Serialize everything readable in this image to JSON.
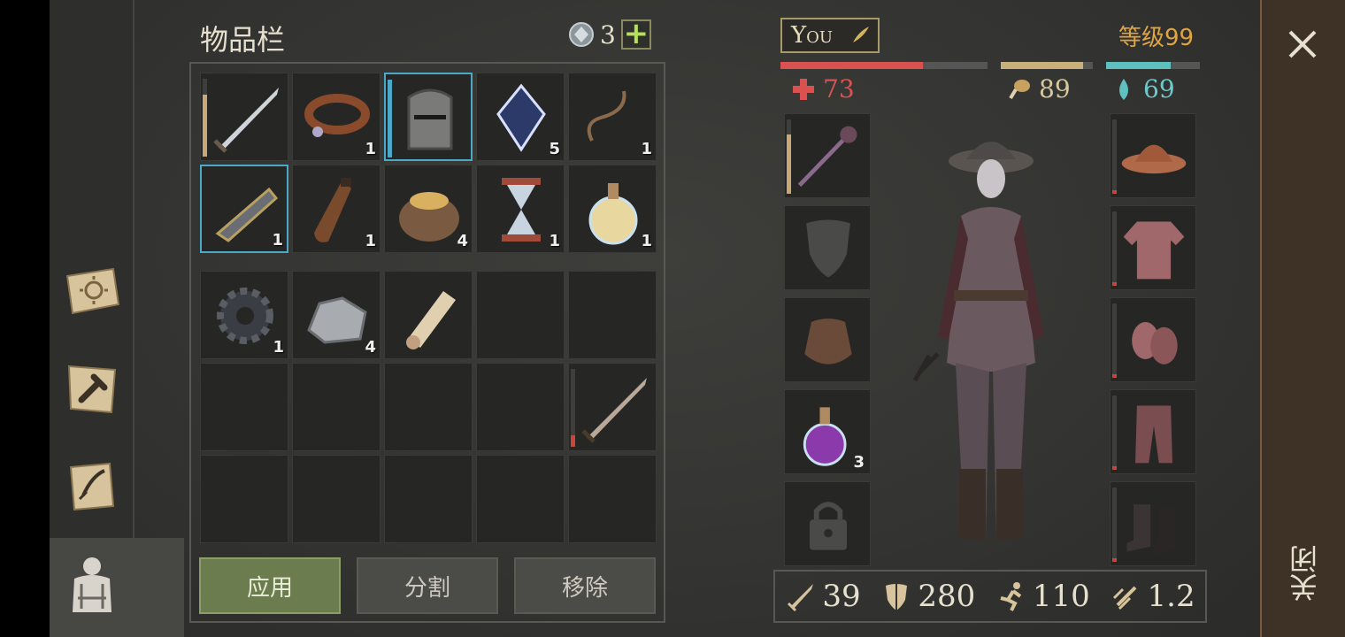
{
  "inventory": {
    "title": "物品栏",
    "gem_count": "3",
    "plus_label": "+",
    "slots_top": [
      {
        "icon": "sword-icon",
        "qty": "",
        "durability": 0.8,
        "selected": false
      },
      {
        "icon": "collar-icon",
        "qty": "1",
        "selected": false
      },
      {
        "icon": "knight-helmet-icon",
        "qty": "",
        "durability": 1.0,
        "selected": true
      },
      {
        "icon": "crystal-icon",
        "qty": "5",
        "selected": false
      },
      {
        "icon": "rope-icon",
        "qty": "1",
        "selected": false
      },
      {
        "icon": "crossbow-part-icon",
        "qty": "1",
        "selected": true
      },
      {
        "icon": "leather-flask-icon",
        "qty": "1",
        "selected": false
      },
      {
        "icon": "grain-sack-icon",
        "qty": "4",
        "selected": false
      },
      {
        "icon": "hourglass-icon",
        "qty": "1",
        "selected": false
      },
      {
        "icon": "potion-icon",
        "qty": "1",
        "selected": false
      }
    ],
    "slots_bottom": [
      {
        "icon": "gear-icon",
        "qty": "1"
      },
      {
        "icon": "ore-icon",
        "qty": "4"
      },
      {
        "icon": "scroll-icon",
        "qty": ""
      },
      {
        "icon": "",
        "qty": ""
      },
      {
        "icon": "",
        "qty": ""
      },
      {
        "icon": "",
        "qty": ""
      },
      {
        "icon": "",
        "qty": ""
      },
      {
        "icon": "",
        "qty": ""
      },
      {
        "icon": "",
        "qty": ""
      },
      {
        "icon": "longsword-icon",
        "qty": "",
        "durability": 0.15
      },
      {
        "icon": "",
        "qty": ""
      },
      {
        "icon": "",
        "qty": ""
      },
      {
        "icon": "",
        "qty": ""
      },
      {
        "icon": "",
        "qty": ""
      },
      {
        "icon": "",
        "qty": ""
      }
    ],
    "buttons": {
      "apply": "应用",
      "split": "分割",
      "remove": "移除"
    }
  },
  "player": {
    "name": "You",
    "level": "等级99",
    "health": {
      "value": "73",
      "fraction": 0.69,
      "color": "#d9524f"
    },
    "food": {
      "value": "89",
      "fraction": 0.89,
      "color": "#c8b07a"
    },
    "water": {
      "value": "69",
      "fraction": 0.69,
      "color": "#5fc0c0"
    }
  },
  "equipment": {
    "left": [
      {
        "icon": "mace-icon",
        "qty": "",
        "durability": 0.8
      },
      {
        "icon": "shield-slot-icon",
        "qty": ""
      },
      {
        "icon": "pouch-icon",
        "qty": ""
      },
      {
        "icon": "purple-potion-icon",
        "qty": "3"
      },
      {
        "icon": "lock-icon",
        "qty": ""
      }
    ],
    "right": [
      {
        "icon": "kettle-hat-icon",
        "durability": 0.05
      },
      {
        "icon": "chainmail-shirt-icon",
        "durability": 0.05
      },
      {
        "icon": "chainmail-gloves-icon",
        "durability": 0.05
      },
      {
        "icon": "chainmail-pants-icon",
        "durability": 0.05
      },
      {
        "icon": "boots-icon",
        "durability": 0.05
      }
    ]
  },
  "combat_stats": {
    "attack": "39",
    "armor": "280",
    "speed": "110",
    "attack_speed": "1.2"
  },
  "close": {
    "label": "关闭"
  }
}
